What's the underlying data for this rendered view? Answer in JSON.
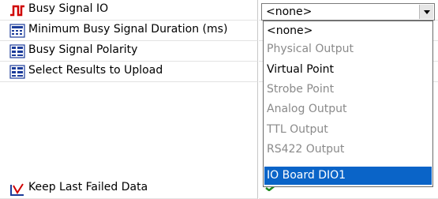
{
  "rows": [
    {
      "label": "Busy Signal IO",
      "icon": "pulse-icon"
    },
    {
      "label": "Minimum Busy Signal Duration (ms)",
      "icon": "calculator-icon"
    },
    {
      "label": "Busy Signal Polarity",
      "icon": "list-icon"
    },
    {
      "label": "Select Results to Upload",
      "icon": "list-icon"
    },
    {
      "label": "Keep Last Failed Data",
      "icon": "chart-icon"
    }
  ],
  "combo": {
    "value": "<none>"
  },
  "dropdown": {
    "options": [
      {
        "label": "<none>",
        "state": "normal"
      },
      {
        "label": "Physical Output",
        "state": "dim"
      },
      {
        "label": "Virtual Point",
        "state": "normal"
      },
      {
        "label": "Strobe Point",
        "state": "dim"
      },
      {
        "label": "Analog Output",
        "state": "dim"
      },
      {
        "label": "TTL Output",
        "state": "dim"
      },
      {
        "label": "RS422 Output",
        "state": "dim"
      },
      {
        "label": "IO Board DIO1",
        "state": "selected"
      }
    ]
  },
  "colors": {
    "selection": "#0a64c8",
    "pulse": "#d00000",
    "icon_blue": "#1b3b9a",
    "check_green": "#1f8a1f"
  }
}
